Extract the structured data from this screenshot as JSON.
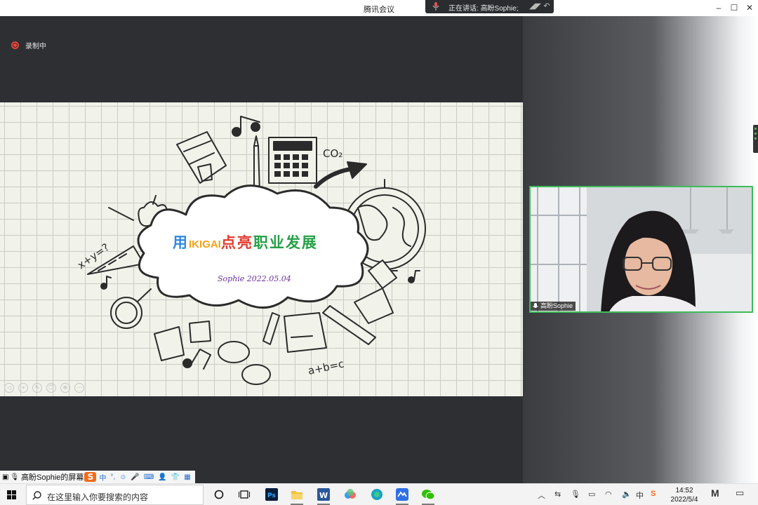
{
  "window": {
    "title": "腾讯会议"
  },
  "speaking": {
    "prefix": "正在讲话:",
    "name": "高盼Sophie;"
  },
  "window_controls": {
    "minimize": "–",
    "maximize": "☐",
    "close": "✕"
  },
  "recording": {
    "label": "录制中",
    "color": "#e9453b"
  },
  "slide": {
    "title_parts": [
      {
        "text": "用",
        "color": "#2f88e0"
      },
      {
        "text": "IKIGAI",
        "color": "#f2a21a"
      },
      {
        "text": "点",
        "color": "#e23a2e"
      },
      {
        "text": "亮",
        "color": "#e23a2e"
      },
      {
        "text": "职",
        "color": "#25a046"
      },
      {
        "text": "业",
        "color": "#25a046"
      },
      {
        "text": "发",
        "color": "#25a046"
      },
      {
        "text": "展",
        "color": "#25a046"
      }
    ],
    "subtitle": "Sophie  2022.05.04",
    "doodle_texts": {
      "co2": "CO₂",
      "formula": "a+b=c",
      "xy": "x+y=?"
    }
  },
  "video": {
    "participant_name": "高盼Sophie",
    "border_color": "#3bbd5a"
  },
  "sharebar": {
    "label": "高盼Sophie的屏幕",
    "ime_logo": "S",
    "ime_mode": "中",
    "ime_punct": "°,"
  },
  "taskbar": {
    "search_placeholder": "在这里输入你要搜索的内容",
    "apps": [
      "task-view",
      "photoshop",
      "file-explorer",
      "word",
      "baidu-netdisk",
      "edge",
      "tencent-meeting",
      "wechat"
    ],
    "clock_time": "14:52",
    "clock_date": "2022/5/4",
    "ime_indicator": "中"
  }
}
